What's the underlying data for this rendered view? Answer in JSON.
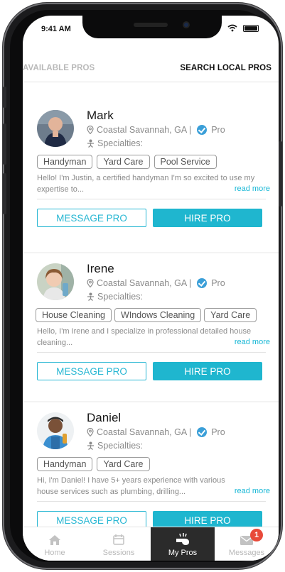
{
  "status": {
    "time": "9:41 AM"
  },
  "topnav": {
    "available": "AVAILABLE PROS",
    "search": "SEARCH LOCAL PROS"
  },
  "pros": [
    {
      "name": "Mark",
      "location": "Coastal Savannah, GA |",
      "badge": "Pro",
      "specialties_label": "Specialties:",
      "tags": [
        "Handyman",
        "Yard Care",
        "Pool Service"
      ],
      "bio": "Hello! I'm Justin, a certified handyman I'm so excited to use my expertise to...",
      "read_more": "read more",
      "message": "MESSAGE PRO",
      "hire": "HIRE PRO"
    },
    {
      "name": "Irene",
      "location": "Coastal Savannah, GA |",
      "badge": "Pro",
      "specialties_label": "Specialties:",
      "tags": [
        "House Cleaning",
        "WIndows Cleaning",
        "Yard Care"
      ],
      "bio": "Hello, I'm Irene and I specialize in professional detailed house cleaning...",
      "read_more": "read more",
      "message": "MESSAGE PRO",
      "hire": "HIRE PRO"
    },
    {
      "name": "Daniel",
      "location": "Coastal Savannah, GA |",
      "badge": "Pro",
      "specialties_label": "Specialties:",
      "tags": [
        "Handyman",
        "Yard Care"
      ],
      "bio": "Hi, I'm Daniel! I have 5+ years experience with various house services such as plumbing, drilling...",
      "read_more": "read more",
      "message": "MESSAGE PRO",
      "hire": "HIRE PRO"
    }
  ],
  "tabbar": {
    "home": "Home",
    "sessions": "Sessions",
    "mypros": "My Pros",
    "messages": "Messages",
    "messages_badge": "1"
  },
  "colors": {
    "accent": "#1fb6cf",
    "badge": "#e84a3a",
    "active_tab": "#2b2b2b"
  }
}
